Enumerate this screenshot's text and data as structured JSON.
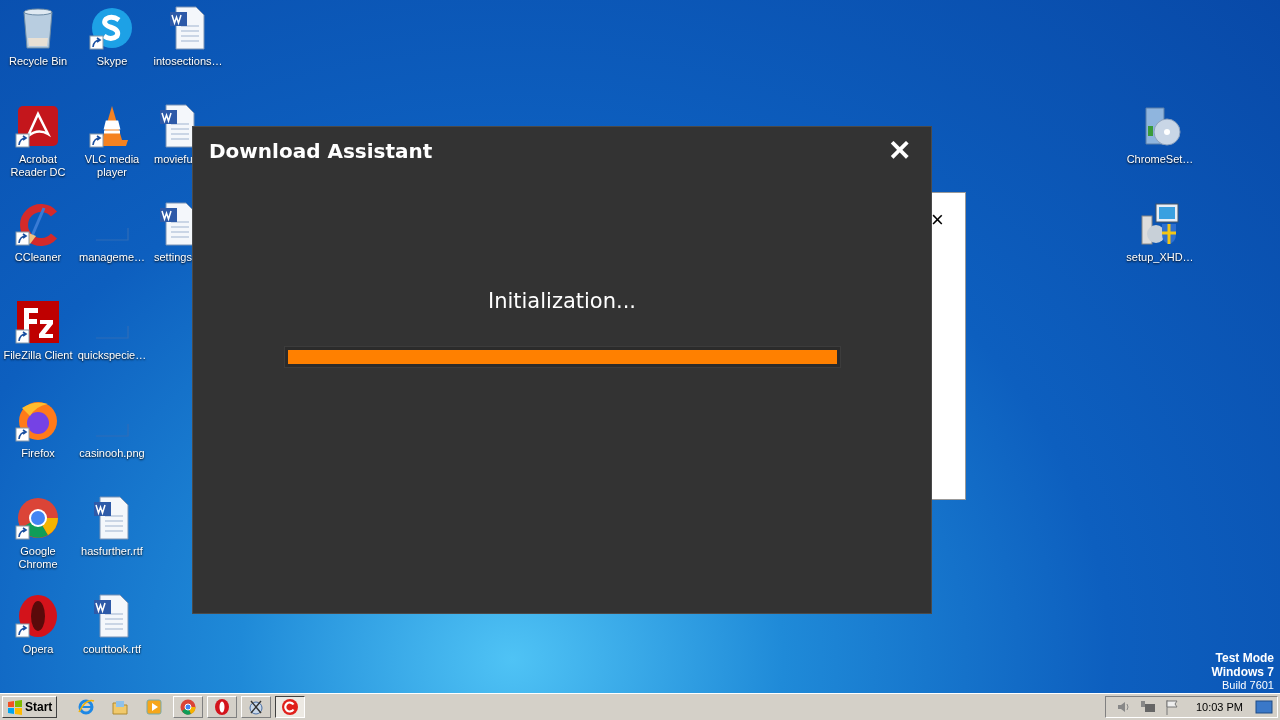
{
  "desktop_icons": [
    {
      "kind": "recycle",
      "label": "Recycle Bin",
      "shortcut": false
    },
    {
      "kind": "acrobat",
      "label": "Acrobat Reader DC",
      "shortcut": true
    },
    {
      "kind": "ccleaner",
      "label": "CCleaner",
      "shortcut": true
    },
    {
      "kind": "filezilla",
      "label": "FileZilla Client",
      "shortcut": true
    },
    {
      "kind": "firefox",
      "label": "Firefox",
      "shortcut": true
    },
    {
      "kind": "chrome",
      "label": "Google Chrome",
      "shortcut": true
    },
    {
      "kind": "opera",
      "label": "Opera",
      "shortcut": true
    },
    {
      "kind": "skype",
      "label": "Skype",
      "shortcut": true
    },
    {
      "kind": "vlc",
      "label": "VLC media player",
      "shortcut": true
    },
    {
      "kind": "blank",
      "label": "manageme…",
      "shortcut": false
    },
    {
      "kind": "blank",
      "label": "quickspecie…",
      "shortcut": false
    },
    {
      "kind": "blank",
      "label": "casinooh.png",
      "shortcut": false
    },
    {
      "kind": "word",
      "label": "hasfurther.rtf",
      "shortcut": false
    },
    {
      "kind": "word",
      "label": "courttook.rtf",
      "shortcut": false
    },
    {
      "kind": "word",
      "label": "intosections…",
      "shortcut": false
    },
    {
      "kind": "word",
      "label": "moviefu",
      "shortcut": false
    },
    {
      "kind": "word",
      "label": "settings",
      "shortcut": false
    }
  ],
  "right_icons": [
    {
      "kind": "setupbox",
      "label": "ChromeSet…",
      "shortcut": false
    },
    {
      "kind": "installer",
      "label": "setup_XHD…",
      "shortcut": false
    }
  ],
  "background_window": {
    "close": "×"
  },
  "dialog": {
    "title": "Download Assistant",
    "close": "✕",
    "message": "Initialization...",
    "progress": {
      "level": 1
    }
  },
  "watermark_text": [
    "Test Mode",
    "Windows 7",
    "Build 7601"
  ],
  "taskbar": {
    "start": "Start",
    "apps": [
      {
        "kind": "ie",
        "selected": false
      },
      {
        "kind": "folder",
        "selected": false
      },
      {
        "kind": "media",
        "selected": false
      },
      {
        "kind": "chrome",
        "selected": false
      },
      {
        "kind": "opera",
        "selected": false
      },
      {
        "kind": "tool",
        "selected": false
      },
      {
        "kind": "red-c",
        "selected": true
      }
    ],
    "clock": "10:03 PM"
  }
}
